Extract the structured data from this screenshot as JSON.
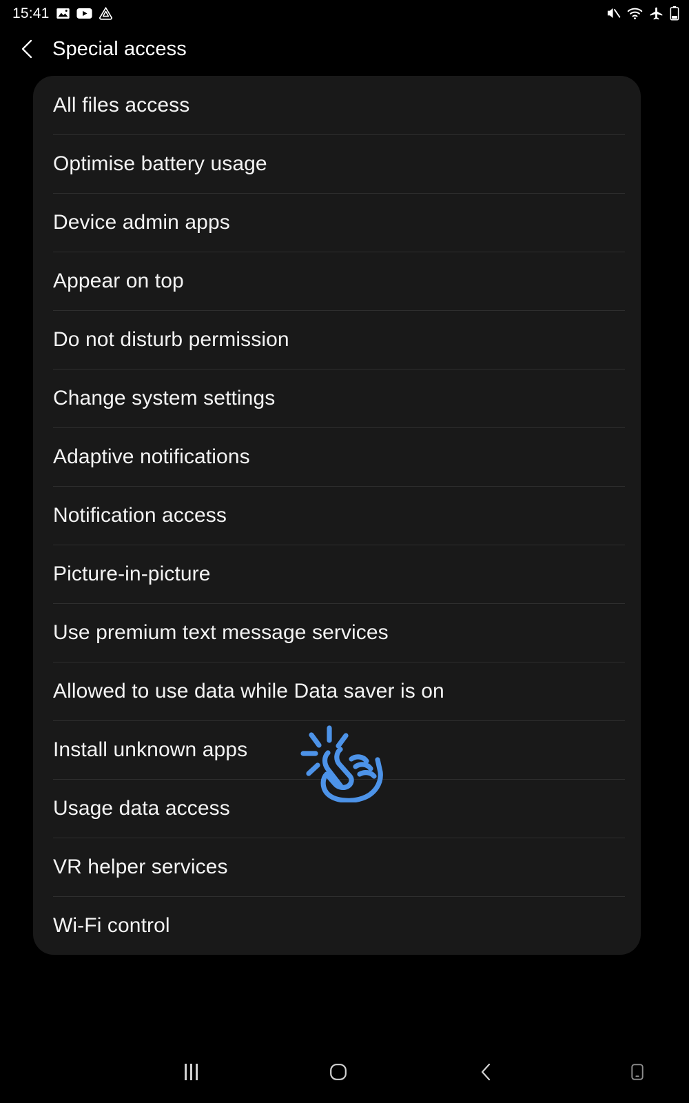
{
  "status_bar": {
    "clock": "15:41",
    "left_icons": [
      {
        "name": "gallery-icon",
        "label": "Gallery"
      },
      {
        "name": "youtube-icon",
        "label": "YouTube"
      },
      {
        "name": "drive-icon",
        "label": "Drive"
      }
    ],
    "right_icons": [
      {
        "name": "mute-icon",
        "label": "Sound muted"
      },
      {
        "name": "wifi-icon",
        "label": "Wi-Fi connected"
      },
      {
        "name": "airplane-mode-icon",
        "label": "Airplane mode"
      },
      {
        "name": "battery-icon",
        "label": "Battery"
      }
    ]
  },
  "action_bar": {
    "back_icon": "chevron-left-icon",
    "title": "Special access"
  },
  "settings_list": {
    "items": [
      {
        "label": "All files access"
      },
      {
        "label": "Optimise battery usage"
      },
      {
        "label": "Device admin apps"
      },
      {
        "label": "Appear on top"
      },
      {
        "label": "Do not disturb permission"
      },
      {
        "label": "Change system settings"
      },
      {
        "label": "Adaptive notifications"
      },
      {
        "label": "Notification access"
      },
      {
        "label": "Picture-in-picture"
      },
      {
        "label": "Use premium text message services"
      },
      {
        "label": "Allowed to use data while Data saver is on"
      },
      {
        "label": "Install unknown apps"
      },
      {
        "label": "Usage data access"
      },
      {
        "label": "VR helper services"
      },
      {
        "label": "Wi-Fi control"
      }
    ]
  },
  "tap_indicator": {
    "icon": "tap-hand-icon",
    "target_item": "Install unknown apps",
    "color": "#4d93e8"
  },
  "navigation_bar": {
    "buttons": [
      {
        "name": "recents-button",
        "icon": "recents-icon"
      },
      {
        "name": "home-button",
        "icon": "home-icon"
      },
      {
        "name": "back-button",
        "icon": "chevron-left-icon"
      },
      {
        "name": "keyboard-button",
        "icon": "keyboard-device-icon"
      }
    ]
  },
  "colors": {
    "background": "#000000",
    "card_background": "#191919",
    "divider": "#2e2e2e",
    "primary_text": "#f3f3f3",
    "accent": "#4d93e8"
  }
}
